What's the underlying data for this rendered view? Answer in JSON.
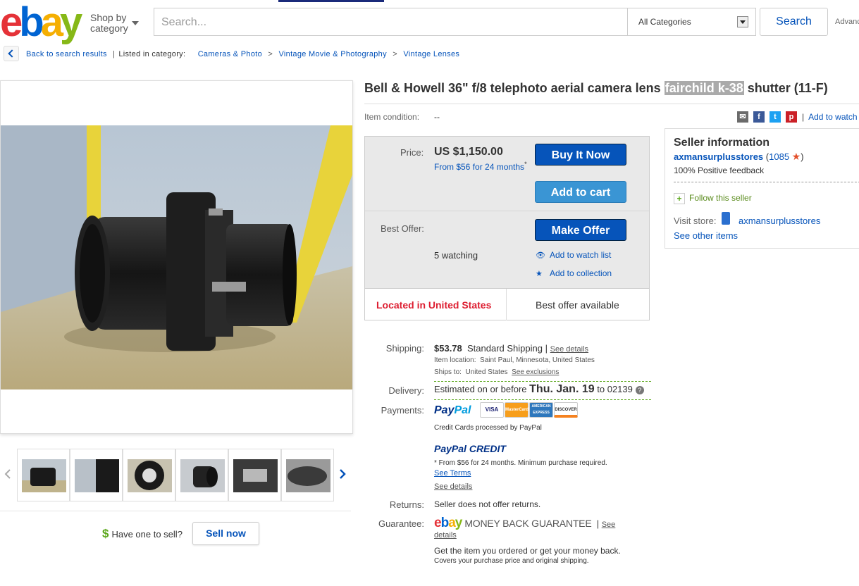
{
  "header": {
    "logo_text": "ebay",
    "shop_by_line1": "Shop by",
    "shop_by_line2": "category",
    "search_placeholder": "Search...",
    "category_select": "All Categories",
    "search_button": "Search",
    "advanced_link": "Advanced"
  },
  "breadcrumb": {
    "back_link": "Back to search results",
    "listed_in": "Listed in category:",
    "categories": [
      "Cameras & Photo",
      "Vintage Movie & Photography",
      "Vintage Lenses"
    ],
    "separator": ">"
  },
  "listing": {
    "title_part1": "Bell & Howell 36\" f/8 telephoto aerial camera lens ",
    "title_highlight": "fairchild k-38",
    "title_part2": " shutter (11-F)",
    "condition_label": "Item condition:",
    "condition_value": "--"
  },
  "share": {
    "icons": [
      "email-icon",
      "facebook-icon",
      "twitter-icon",
      "pinterest-icon"
    ],
    "separator": "|",
    "add_to_watch": "Add to watch list"
  },
  "purchase": {
    "price_label": "Price:",
    "price_value": "US $1,150.00",
    "financing": "From $56 for 24 months",
    "financing_mark": "*",
    "buy_now": "Buy It Now",
    "add_to_cart": "Add to cart",
    "best_offer_label": "Best Offer:",
    "make_offer": "Make Offer",
    "watching": "5 watching",
    "add_watch_list": "Add to watch list",
    "add_collection": "Add to collection",
    "located": "Located in United States",
    "best_offer_available": "Best offer available"
  },
  "seller": {
    "heading": "Seller information",
    "name": "axmansurplusstores",
    "feedback_score": "1085",
    "positive_feedback": "100% Positive feedback",
    "follow": "Follow this seller",
    "visit_store_label": "Visit store:",
    "store_name": "axmansurplusstores",
    "see_other": "See other items"
  },
  "shipping": {
    "label": "Shipping:",
    "cost": "$53.78",
    "method": "Standard Shipping",
    "separator": "|",
    "see_details": "See details",
    "item_location_label": "Item location:",
    "item_location": "Saint Paul, Minnesota, United States",
    "ships_to_label": "Ships to:",
    "ships_to": "United States",
    "see_exclusions": "See exclusions"
  },
  "delivery": {
    "label": "Delivery:",
    "prefix": "Estimated on or before",
    "date": "Thu. Jan. 19",
    "to": "to",
    "zip": "02139",
    "help": "?"
  },
  "payments": {
    "label": "Payments:",
    "paypal_a": "Pay",
    "paypal_b": "Pal",
    "cards": [
      "VISA",
      "MasterCard",
      "AMERICAN EXPRESS",
      "DISCOVER"
    ],
    "processed": "Credit Cards processed by PayPal",
    "credit_a": "PayPal",
    "credit_b": " CREDIT",
    "credit_note": "* From $56 for 24 months. Minimum purchase required.",
    "see_terms": "See Terms",
    "see_details": "See details"
  },
  "returns": {
    "label": "Returns:",
    "value": "Seller does not offer returns."
  },
  "guarantee": {
    "label": "Guarantee:",
    "logo": "ebay",
    "text": "MONEY BACK GUARANTEE",
    "separator": "|",
    "see": "See",
    "details": "details",
    "line1": "Get the item you ordered or get your money back.",
    "line2": "Covers your purchase price and original shipping."
  },
  "sell": {
    "question": "Have one to sell?",
    "dollar": "$",
    "button": "Sell now"
  },
  "colors": {
    "ebay_red": "#e53238",
    "ebay_blue": "#0654ba",
    "ebay_yellow": "#f5af02",
    "ebay_green": "#86b817",
    "location_red": "#dd1e31"
  }
}
